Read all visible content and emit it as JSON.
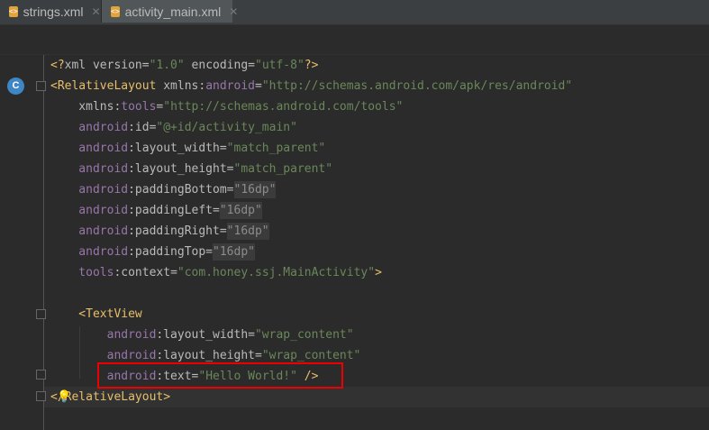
{
  "tabs": [
    {
      "label": "strings.xml",
      "active": false
    },
    {
      "label": "activity_main.xml",
      "active": true
    }
  ],
  "gutter": {
    "class_badge": "C"
  },
  "code": [
    [
      [
        "t",
        "<?"
      ],
      [
        "a",
        "xml version="
      ],
      [
        "v",
        "\"1.0\""
      ],
      [
        "a",
        " encoding="
      ],
      [
        "v",
        "\"utf-8\""
      ],
      [
        "t",
        "?>"
      ]
    ],
    [
      [
        "t",
        "<RelativeLayout"
      ],
      [
        "a",
        " xmlns:"
      ],
      [
        "n",
        "android"
      ],
      [
        "a",
        "="
      ],
      [
        "v",
        "\"http://schemas.android.com/apk/res/android\""
      ]
    ],
    [
      [
        "a",
        "    xmlns:"
      ],
      [
        "n",
        "tools"
      ],
      [
        "a",
        "="
      ],
      [
        "v",
        "\"http://schemas.android.com/tools\""
      ]
    ],
    [
      [
        "n",
        "    android"
      ],
      [
        "a",
        ":id="
      ],
      [
        "v",
        "\"@+id/activity_main\""
      ]
    ],
    [
      [
        "n",
        "    android"
      ],
      [
        "a",
        ":layout_width="
      ],
      [
        "v",
        "\"match_parent\""
      ]
    ],
    [
      [
        "n",
        "    android"
      ],
      [
        "a",
        ":layout_height="
      ],
      [
        "v",
        "\"match_parent\""
      ]
    ],
    [
      [
        "n",
        "    android"
      ],
      [
        "a",
        ":paddingBottom="
      ],
      [
        "g",
        "\"16dp\""
      ]
    ],
    [
      [
        "n",
        "    android"
      ],
      [
        "a",
        ":paddingLeft="
      ],
      [
        "g",
        "\"16dp\""
      ]
    ],
    [
      [
        "n",
        "    android"
      ],
      [
        "a",
        ":paddingRight="
      ],
      [
        "g",
        "\"16dp\""
      ]
    ],
    [
      [
        "n",
        "    android"
      ],
      [
        "a",
        ":paddingTop="
      ],
      [
        "g",
        "\"16dp\""
      ]
    ],
    [
      [
        "n",
        "    tools"
      ],
      [
        "a",
        ":context="
      ],
      [
        "v",
        "\"com.honey.ssj.MainActivity\""
      ],
      [
        "t",
        ">"
      ]
    ],
    [],
    [
      [
        "t",
        "    <TextView"
      ]
    ],
    [
      [
        "n",
        "        android"
      ],
      [
        "a",
        ":layout_width="
      ],
      [
        "v",
        "\"wrap_content\""
      ]
    ],
    [
      [
        "n",
        "        android"
      ],
      [
        "a",
        ":layout_height="
      ],
      [
        "v",
        "\"wrap_content\""
      ]
    ],
    [
      [
        "n",
        "        android"
      ],
      [
        "a",
        ":text="
      ],
      [
        "v",
        "\"Hello World!\""
      ],
      [
        "t",
        " />"
      ]
    ],
    [
      [
        "t",
        "</RelativeLayout>"
      ]
    ]
  ],
  "colors": {
    "tag": "#e8bf6a",
    "namespace": "#9876aa",
    "value": "#6a8759",
    "highlight_box": "#e00000"
  }
}
